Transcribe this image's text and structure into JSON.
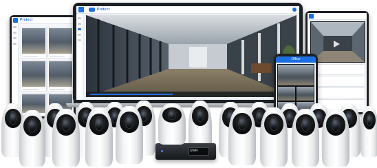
{
  "scene": {
    "background": "#ffffff",
    "accent": "#1b6fe0",
    "device_dark": "#1c1f24",
    "camera_white": "#f4f5f6",
    "camera_lens": "#0b0c0d"
  },
  "laptop": {
    "brand": "Protect"
  },
  "left_tablet": {
    "brand": "Protect"
  },
  "phone": {
    "header": "Office"
  },
  "recorder": {
    "label": "UniFi"
  },
  "icons": [
    "ubiquiti-logo-icon",
    "unifi-protect-logo-icon",
    "camera-icon",
    "play-icon"
  ]
}
